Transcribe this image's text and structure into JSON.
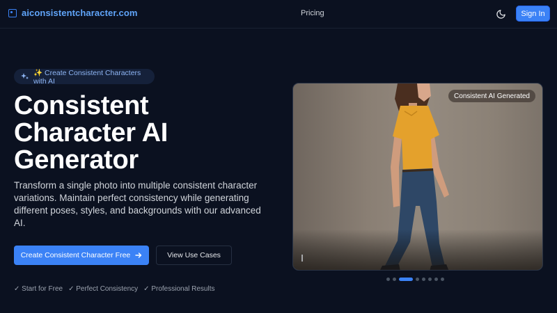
{
  "header": {
    "brand": "aiconsistentcharacter.com",
    "nav_pricing": "Pricing",
    "sign_in": "Sign In",
    "theme_icon": "moon-icon"
  },
  "hero": {
    "badge": "✨ Create Consistent Characters with AI",
    "title_lines": [
      "Consistent",
      "Character AI",
      "Generator"
    ],
    "description": "Transform a single photo into multiple consistent character variations. Maintain perfect consistency while generating different poses, styles, and backgrounds with our advanced AI.",
    "cta_primary": "Create Consistent Character Free",
    "cta_primary_icon": "arrow-right-icon",
    "cta_secondary": "View Use Cases",
    "features": [
      "✓ Start for Free",
      "✓ Perfect Consistency",
      "✓ Professional Results"
    ]
  },
  "showcase": {
    "label": "Consistent AI Generated",
    "carousel": {
      "total": 8,
      "active_index": 2
    }
  },
  "colors": {
    "background": "#0b1120",
    "accent": "#3b82f6",
    "brand_text": "#60a5fa"
  }
}
